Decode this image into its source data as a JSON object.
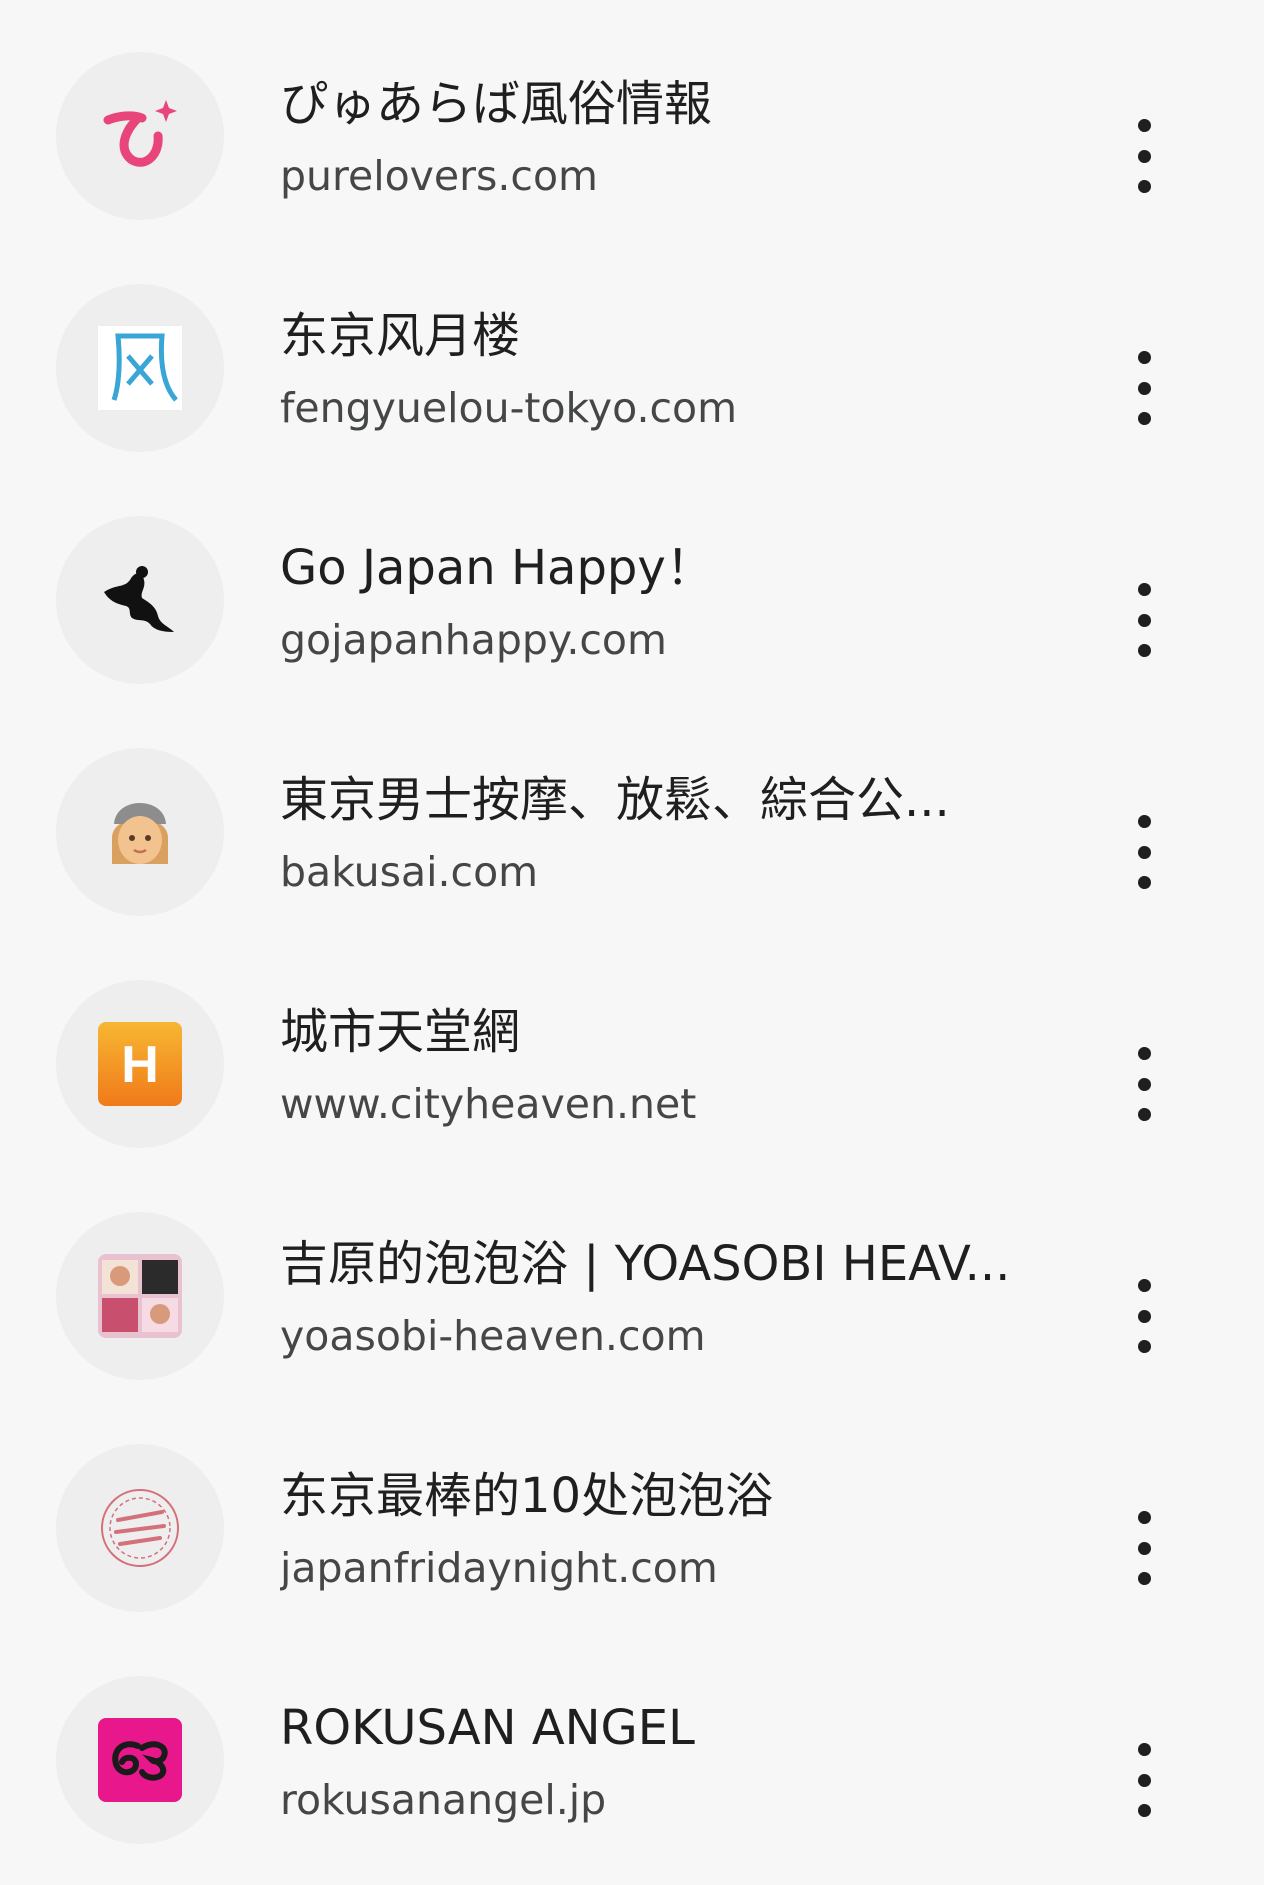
{
  "sites": [
    {
      "title": "ぴゅあらば風俗情報",
      "url": "purelovers.com",
      "icon": "pyu-logo-icon",
      "icon_color": "#e8457a"
    },
    {
      "title": "东京风月楼",
      "url": "fengyuelou-tokyo.com",
      "icon": "kaze-character-icon",
      "icon_color": "#3aa6d6"
    },
    {
      "title": "Go Japan Happy！",
      "url": "gojapanhappy.com",
      "icon": "cupid-silhouette-icon",
      "icon_color": "#111111"
    },
    {
      "title": "東京男士按摩、放鬆、綜合公...",
      "url": "bakusai.com",
      "icon": "face-emoji-icon",
      "icon_color": "#e8b07a"
    },
    {
      "title": "城市天堂網",
      "url": "www.cityheaven.net",
      "icon": "h-logo-icon",
      "icon_color": "#f59a1e",
      "icon_text": "H"
    },
    {
      "title": "吉原的泡泡浴 | YOASOBI HEAV...",
      "url": "yoasobi-heaven.com",
      "icon": "photo-collage-icon",
      "icon_color": "#c8506e"
    },
    {
      "title": "东京最棒的10处泡泡浴",
      "url": "japanfridaynight.com",
      "icon": "japan-friday-night-stamp-icon",
      "icon_color": "#d4707a"
    },
    {
      "title": "ROKUSAN ANGEL",
      "url": "rokusanangel.jp",
      "icon": "rokusan-logo-icon",
      "icon_color": "#e8178c"
    }
  ]
}
